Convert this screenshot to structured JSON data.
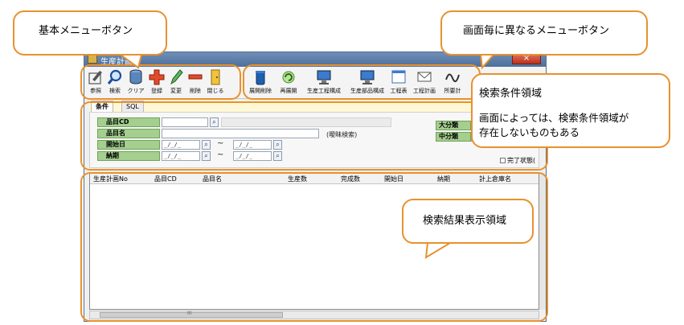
{
  "window": {
    "title": "生産計画",
    "close_label": "×"
  },
  "annotations": {
    "basic_menu": "基本メニューボタン",
    "screen_menu": "画面毎に異なるメニューボタン",
    "search_area_title": "検索条件領域",
    "search_area_body": [
      "画面によっては、検索条件領域が",
      "存在しないものもある"
    ],
    "result_area": "検索結果表示領域"
  },
  "toolbar": {
    "basic": [
      {
        "label": "参照",
        "icon": "reference-icon"
      },
      {
        "label": "検索",
        "icon": "magnifier-icon"
      },
      {
        "label": "クリア",
        "icon": "clear-icon"
      },
      {
        "label": "登録",
        "icon": "plus-icon"
      },
      {
        "label": "変更",
        "icon": "pencil-icon"
      },
      {
        "label": "削除",
        "icon": "minus-icon"
      },
      {
        "label": "閉じる",
        "icon": "door-icon"
      }
    ],
    "screen": [
      {
        "label": "展開削除",
        "icon": "trash-icon"
      },
      {
        "label": "再展開",
        "icon": "refresh-icon"
      },
      {
        "label": "生産工程構成",
        "icon": "computer-icon"
      },
      {
        "label": "生産部品構成",
        "icon": "computer-icon"
      },
      {
        "label": "工程表",
        "icon": "window-icon"
      },
      {
        "label": "工程計画",
        "icon": "envelope-icon"
      },
      {
        "label": "所要計",
        "icon": "scribble-icon"
      }
    ]
  },
  "tabs": [
    {
      "label": "条件"
    },
    {
      "label": "SQL"
    }
  ],
  "conditions": {
    "item_cd": "品目CD",
    "item_name": "品目名",
    "fuzzy_hint": "(曖昧検索)",
    "start_date": "開始日",
    "due_date": "納期",
    "date_placeholder": "_/_/_",
    "range_sep": "~",
    "major_class": "大分類",
    "minor_class": "中分類",
    "completed_state": "完了状態("
  },
  "results": {
    "columns": [
      "生産計画No",
      "品目CD",
      "品目名",
      "生産数",
      "完成数",
      "開始日",
      "納期",
      "計上倉庫名"
    ],
    "scroll_marker": "III"
  },
  "colors": {
    "callout_border": "#e8912e",
    "label_green": "#a4cf8f"
  }
}
